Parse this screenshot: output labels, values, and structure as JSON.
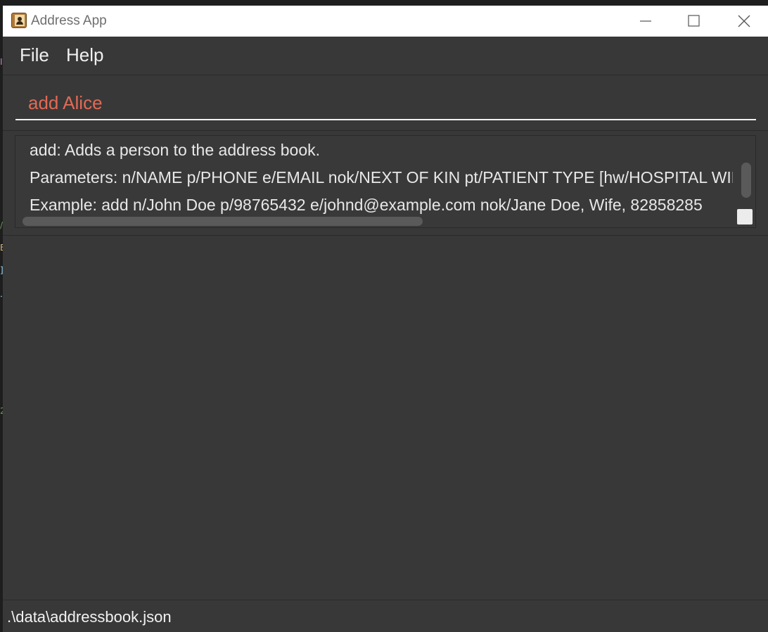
{
  "window": {
    "title": "Address App",
    "controls": [
      "minimize",
      "maximize",
      "close"
    ]
  },
  "menu": {
    "items": [
      {
        "label": "File"
      },
      {
        "label": "Help"
      }
    ]
  },
  "command_box": {
    "value": "add Alice",
    "text_color": "#e26a55"
  },
  "result_display": {
    "lines": [
      "add: Adds a person to the address book.",
      "Parameters: n/NAME p/PHONE e/EMAIL nok/NEXT OF KIN pt/PATIENT TYPE [hw/HOSPITAL WING] [fn/FLOOR NUMBER] [wn/WARD NUMBER] [m/MEDICATION]... [t/TAG]...",
      "Example: add n/John Doe p/98765432 e/johnd@example.com nok/Jane Doe, Wife, 82858285"
    ]
  },
  "status_bar": {
    "file_path": ".\\data\\addressbook.json"
  },
  "colors": {
    "window_background": "#383838",
    "titlebar_background": "#ffffff",
    "text": "#f0f0f0",
    "command_text": "#e26a55"
  }
}
